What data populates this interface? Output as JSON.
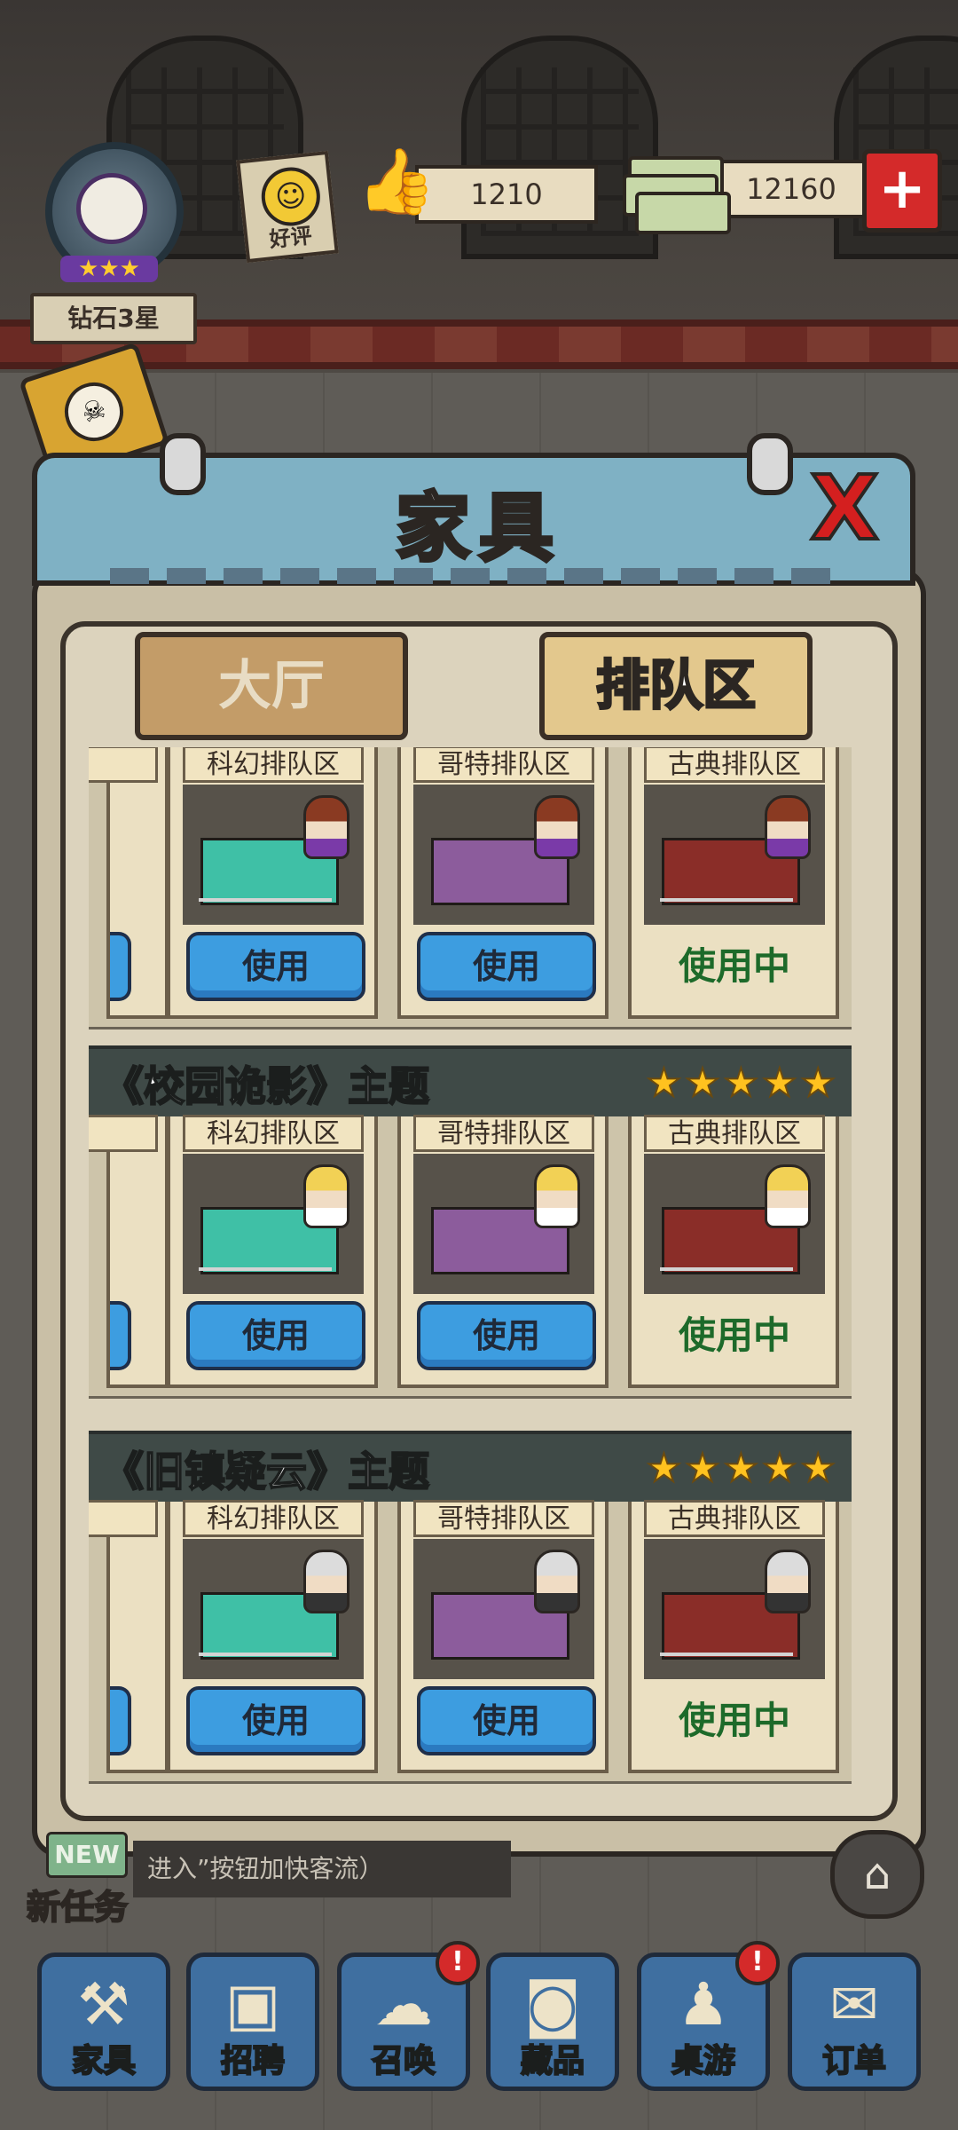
{
  "hud": {
    "rank_label": "钻石3星",
    "rank_stars": "★★★",
    "rating_label": "好评",
    "likes_value": "1210",
    "cash_value": "12160",
    "add_label": "+"
  },
  "panel": {
    "title": "家具",
    "close_label": "X",
    "tabs": [
      {
        "label": "大厅",
        "selected": false
      },
      {
        "label": "排队区",
        "selected": true
      }
    ]
  },
  "sections": [
    {
      "title": "",
      "stars": "",
      "cards": [
        {
          "name": "科幻排队区",
          "action": "使用",
          "in_use": false
        },
        {
          "name": "哥特排队区",
          "action": "使用",
          "in_use": false
        },
        {
          "name": "古典排队区",
          "action": "使用中",
          "in_use": true
        }
      ]
    },
    {
      "title": "《校园诡影》主题",
      "stars": "★★★★★",
      "cards": [
        {
          "name": "科幻排队区",
          "action": "使用",
          "in_use": false
        },
        {
          "name": "哥特排队区",
          "action": "使用",
          "in_use": false
        },
        {
          "name": "古典排队区",
          "action": "使用中",
          "in_use": true
        }
      ]
    },
    {
      "title": "《旧镇疑云》主题",
      "stars": "★★★★★",
      "cards": [
        {
          "name": "科幻排队区",
          "action": "使用",
          "in_use": false
        },
        {
          "name": "哥特排队区",
          "action": "使用",
          "in_use": false
        },
        {
          "name": "古典排队区",
          "action": "使用中",
          "in_use": true
        }
      ]
    }
  ],
  "partial_tag": "区",
  "tasks": {
    "new_badge": "NEW",
    "new_task_label": "新任务",
    "hint_text": "进入”按钮加快客流）"
  },
  "bottom_nav": [
    {
      "label": "家具",
      "icon": "hammer-wrench-icon",
      "alert": false
    },
    {
      "label": "招聘",
      "icon": "clipboard-portrait-icon",
      "alert": false
    },
    {
      "label": "召唤",
      "icon": "ghost-icon",
      "alert": true
    },
    {
      "label": "藏品",
      "icon": "safe-icon",
      "alert": false
    },
    {
      "label": "桌游",
      "icon": "chess-board-icon",
      "alert": true
    },
    {
      "label": "订单",
      "icon": "bat-box-icon",
      "alert": false
    }
  ],
  "alert_mark": "!",
  "colors": {
    "title_bar": "#7fb1c4",
    "use_button": "#3d9de0",
    "in_use_text": "#1d6a2a",
    "star": "#ffc21f",
    "close_x": "#d41f1f"
  }
}
